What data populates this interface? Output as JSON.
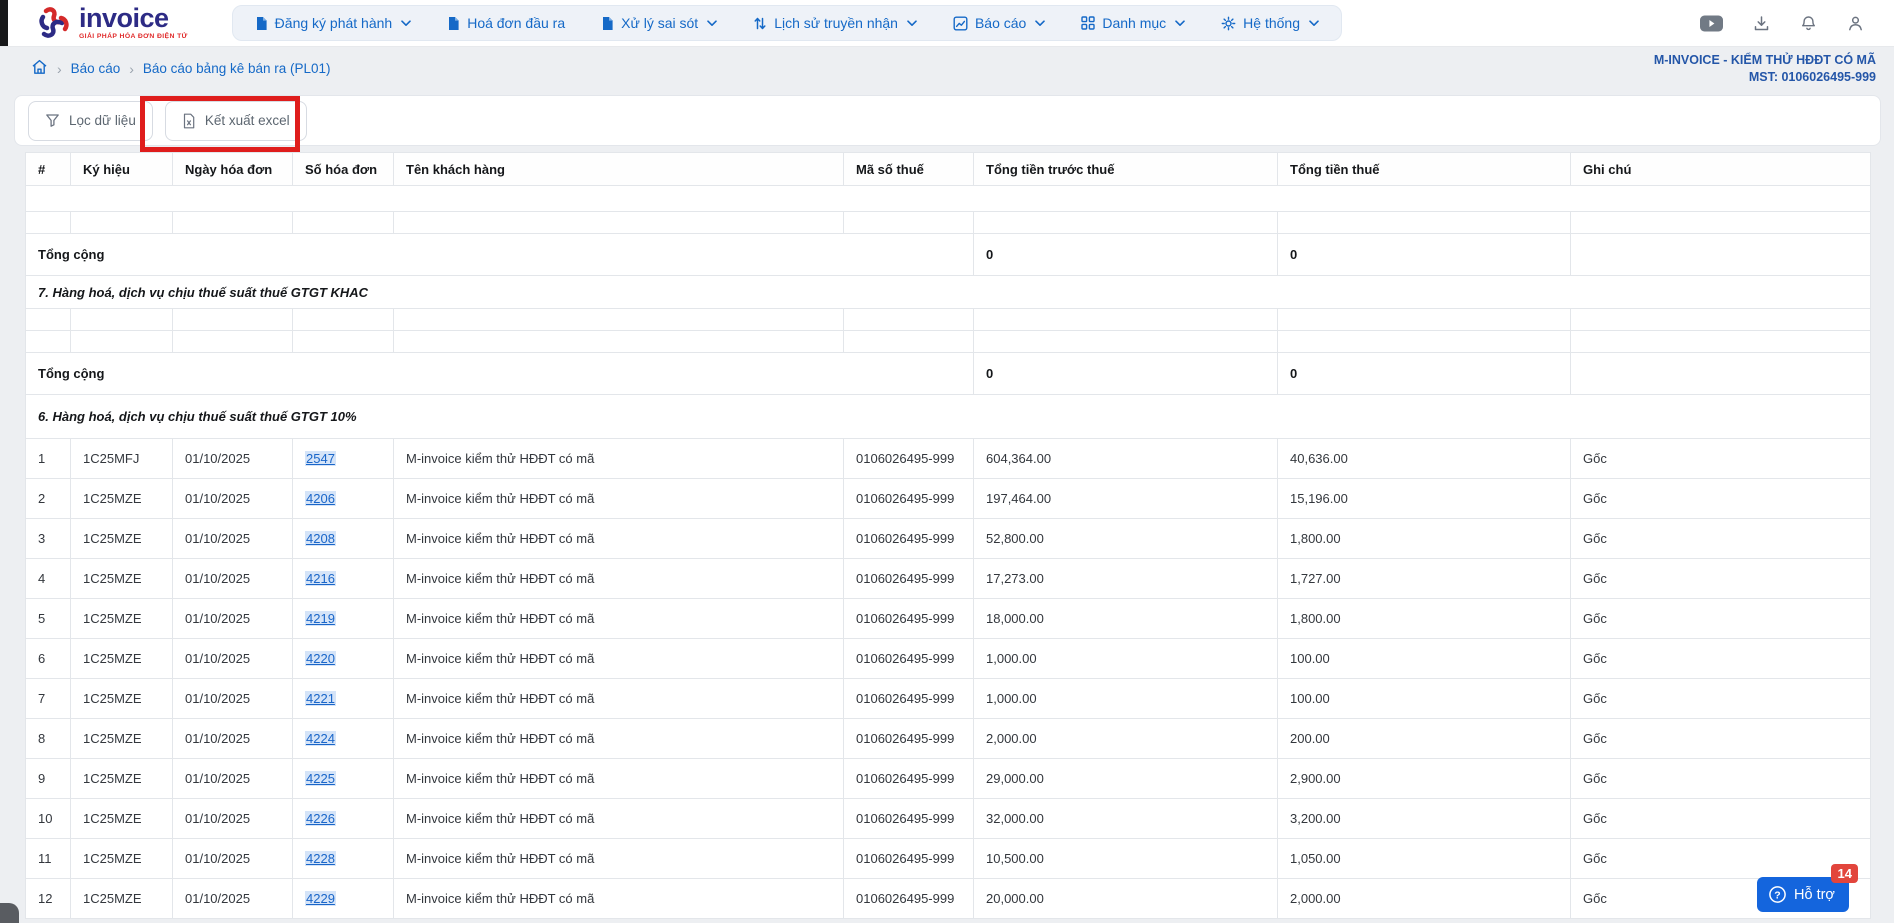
{
  "navbar": {
    "logo_text": "invoice",
    "logo_tagline": "GIẢI PHÁP HÓA ĐƠN ĐIỆN TỬ",
    "menu": [
      {
        "label": "Đăng ký phát hành",
        "icon": "document-icon",
        "chevron": true
      },
      {
        "label": "Hoá đơn đầu ra",
        "icon": "document-icon",
        "chevron": false
      },
      {
        "label": "Xử lý sai sót",
        "icon": "document-icon",
        "chevron": true
      },
      {
        "label": "Lịch sử truyền nhận",
        "icon": "transfer-icon",
        "chevron": true
      },
      {
        "label": "Báo cáo",
        "icon": "chart-icon",
        "chevron": true
      },
      {
        "label": "Danh mục",
        "icon": "grid-icon",
        "chevron": true
      },
      {
        "label": "Hệ thống",
        "icon": "gear-icon",
        "chevron": true
      }
    ],
    "right_icons": [
      "youtube-icon",
      "download-icon",
      "bell-icon",
      "user-icon"
    ]
  },
  "breadcrumb": {
    "items": [
      "Báo cáo",
      "Báo cáo bảng kê bán ra (PL01)"
    ]
  },
  "company": {
    "name": "M-INVOICE - KIỂM THỬ HĐĐT CÓ MÃ",
    "tax_id": "MST: 0106026495-999"
  },
  "toolbar": {
    "filter_label": "Lọc dữ liệu",
    "export_label": "Kết xuất excel"
  },
  "table": {
    "headers": [
      "#",
      "Ký hiệu",
      "Ngày hóa đơn",
      "Số hóa đơn",
      "Tên khách hàng",
      "Mã số thuế",
      "Tổng tiền trước thuế",
      "Tổng tiền thuế",
      "Ghi chú"
    ],
    "total_label": "Tổng cộng",
    "sections": [
      {
        "title": "",
        "empty_rows": 1,
        "rows": [],
        "total": {
          "pre_tax": "0",
          "tax": "0"
        }
      },
      {
        "title": "7. Hàng hoá, dịch vụ chịu thuế suất thuế GTGT KHAC",
        "empty_rows": 2,
        "rows": [],
        "total": {
          "pre_tax": "0",
          "tax": "0"
        }
      },
      {
        "title": "6. Hàng hoá, dịch vụ chịu thuế suất thuế GTGT 10%",
        "empty_rows": 0,
        "rows": [
          {
            "idx": "1",
            "ky_hieu": "1C25MFJ",
            "ngay": "01/10/2025",
            "so": "2547",
            "ten": "M-invoice kiểm thử HĐĐT có mã",
            "mst": "0106026495-999",
            "pre_tax": "604,364.00",
            "tax": "40,636.00",
            "note": "Gốc"
          },
          {
            "idx": "2",
            "ky_hieu": "1C25MZE",
            "ngay": "01/10/2025",
            "so": "4206",
            "ten": "M-invoice kiểm thử HĐĐT có mã",
            "mst": "0106026495-999",
            "pre_tax": "197,464.00",
            "tax": "15,196.00",
            "note": "Gốc"
          },
          {
            "idx": "3",
            "ky_hieu": "1C25MZE",
            "ngay": "01/10/2025",
            "so": "4208",
            "ten": "M-invoice kiểm thử HĐĐT có mã",
            "mst": "0106026495-999",
            "pre_tax": "52,800.00",
            "tax": "1,800.00",
            "note": "Gốc"
          },
          {
            "idx": "4",
            "ky_hieu": "1C25MZE",
            "ngay": "01/10/2025",
            "so": "4216",
            "ten": "M-invoice kiểm thử HĐĐT có mã",
            "mst": "0106026495-999",
            "pre_tax": "17,273.00",
            "tax": "1,727.00",
            "note": "Gốc"
          },
          {
            "idx": "5",
            "ky_hieu": "1C25MZE",
            "ngay": "01/10/2025",
            "so": "4219",
            "ten": "M-invoice kiểm thử HĐĐT có mã",
            "mst": "0106026495-999",
            "pre_tax": "18,000.00",
            "tax": "1,800.00",
            "note": "Gốc"
          },
          {
            "idx": "6",
            "ky_hieu": "1C25MZE",
            "ngay": "01/10/2025",
            "so": "4220",
            "ten": "M-invoice kiểm thử HĐĐT có mã",
            "mst": "0106026495-999",
            "pre_tax": "1,000.00",
            "tax": "100.00",
            "note": "Gốc"
          },
          {
            "idx": "7",
            "ky_hieu": "1C25MZE",
            "ngay": "01/10/2025",
            "so": "4221",
            "ten": "M-invoice kiểm thử HĐĐT có mã",
            "mst": "0106026495-999",
            "pre_tax": "1,000.00",
            "tax": "100.00",
            "note": "Gốc"
          },
          {
            "idx": "8",
            "ky_hieu": "1C25MZE",
            "ngay": "01/10/2025",
            "so": "4224",
            "ten": "M-invoice kiểm thử HĐĐT có mã",
            "mst": "0106026495-999",
            "pre_tax": "2,000.00",
            "tax": "200.00",
            "note": "Gốc"
          },
          {
            "idx": "9",
            "ky_hieu": "1C25MZE",
            "ngay": "01/10/2025",
            "so": "4225",
            "ten": "M-invoice kiểm thử HĐĐT có mã",
            "mst": "0106026495-999",
            "pre_tax": "29,000.00",
            "tax": "2,900.00",
            "note": "Gốc"
          },
          {
            "idx": "10",
            "ky_hieu": "1C25MZE",
            "ngay": "01/10/2025",
            "so": "4226",
            "ten": "M-invoice kiểm thử HĐĐT có mã",
            "mst": "0106026495-999",
            "pre_tax": "32,000.00",
            "tax": "3,200.00",
            "note": "Gốc"
          },
          {
            "idx": "11",
            "ky_hieu": "1C25MZE",
            "ngay": "01/10/2025",
            "so": "4228",
            "ten": "M-invoice kiểm thử HĐĐT có mã",
            "mst": "0106026495-999",
            "pre_tax": "10,500.00",
            "tax": "1,050.00",
            "note": "Gốc"
          },
          {
            "idx": "12",
            "ky_hieu": "1C25MZE",
            "ngay": "01/10/2025",
            "so": "4229",
            "ten": "M-invoice kiểm thử HĐĐT có mã",
            "mst": "0106026495-999",
            "pre_tax": "20,000.00",
            "tax": "2,000.00",
            "note": "Gốc"
          }
        ],
        "total": null
      }
    ]
  },
  "support": {
    "label": "Hỗ trợ",
    "badge": "14"
  }
}
